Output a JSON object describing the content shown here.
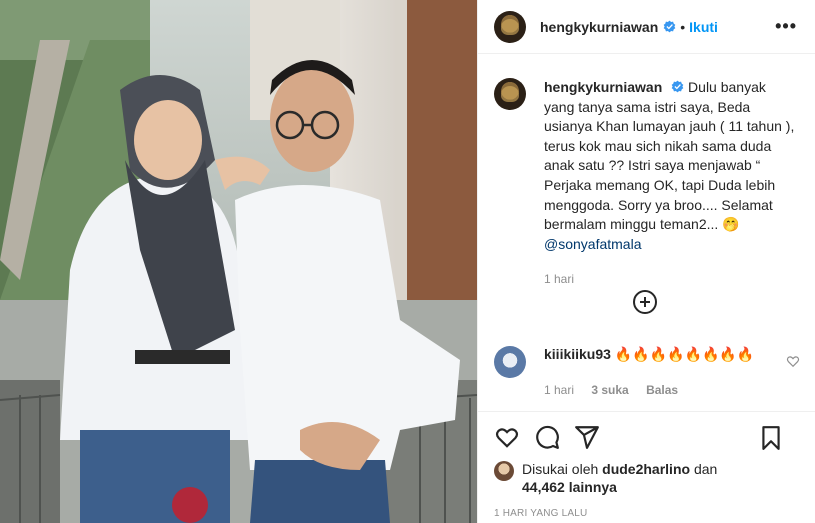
{
  "post": {
    "username": "hengkykurniawan",
    "dot": "•",
    "follow_label": "Ikuti",
    "more_label": "•••",
    "caption": {
      "username": "hengkykurniawan",
      "text": "Dulu banyak yang tanya sama istri saya, Beda usianya Khan lumayan jauh ( 11 tahun ), terus kok mau sich nikah sama duda anak satu ?? Istri saya menjawab “ Perjaka memang OK, tapi Duda lebih menggoda. Sorry ya broo.... Selamat bermalam minggu teman2... 🤭",
      "mention": "@sonyafatmala",
      "time": "1 hari"
    },
    "comment": {
      "username": "kiiikiiku93",
      "text": "🔥🔥🔥🔥🔥🔥🔥🔥",
      "time": "1 hari",
      "likes": "3 suka",
      "reply": "Balas"
    },
    "likes": {
      "prefix": "Disukai oleh",
      "liker": "dude2harlino",
      "joiner": "dan",
      "count": "44,462 lainnya"
    },
    "timestamp": "1 HARI YANG LALU"
  },
  "icons": {
    "verified": "verified-badge-icon",
    "add_comment": "plus-circle-icon",
    "like": "heart-icon",
    "comment": "comment-icon",
    "share": "paper-plane-icon",
    "save": "bookmark-icon"
  },
  "colors": {
    "accent": "#0095f6",
    "mention": "#00376b",
    "muted": "#8e8e8e",
    "text": "#262626"
  }
}
